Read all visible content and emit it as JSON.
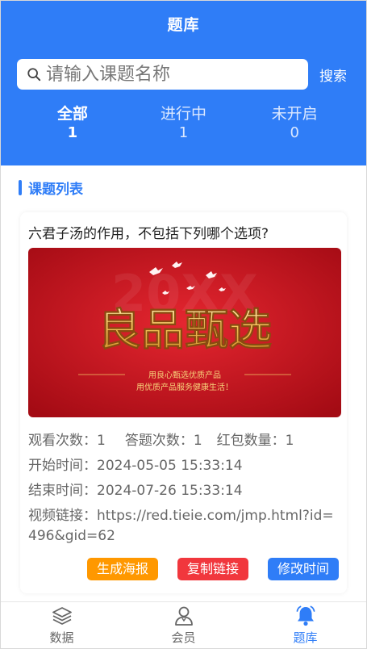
{
  "header": {
    "title": "题库"
  },
  "search": {
    "placeholder": "请输入课题名称",
    "button_label": "搜索"
  },
  "tabs": [
    {
      "label": "全部",
      "count": "1",
      "active": true
    },
    {
      "label": "进行中",
      "count": "1",
      "active": false
    },
    {
      "label": "未开启",
      "count": "0",
      "active": false
    }
  ],
  "section": {
    "title": "课题列表"
  },
  "item": {
    "question": "六君子汤的作用，不包括下列哪个选项?",
    "banner": {
      "title": "良品甄选",
      "watermark": "20XX",
      "line1": "用良心甄选优质产品",
      "line2": "用优质产品服务健康生活！"
    },
    "views_label": "观看次数：",
    "views": "1",
    "answers_label": "答题次数：",
    "answers": "1",
    "redpacket_label": "红包数量：",
    "redpacket": "1",
    "start_label": "开始时间：",
    "start_time": "2024-05-05 15:33:14",
    "end_label": "结束时间：",
    "end_time": "2024-07-26 15:33:14",
    "link_label": "视频链接：",
    "link": "https://red.tieie.com/jmp.html?id=496&gid=62",
    "actions": {
      "poster": "生成海报",
      "copy": "复制链接",
      "edit": "修改时间"
    }
  },
  "nav": [
    {
      "label": "数据",
      "icon": "layers-icon",
      "active": false
    },
    {
      "label": "会员",
      "icon": "user-icon",
      "active": false
    },
    {
      "label": "题库",
      "icon": "bell-icon",
      "active": true
    }
  ],
  "colors": {
    "primary": "#2f7df7",
    "orange": "#ff9800",
    "red": "#f1373d",
    "banner_red": "#c8121e",
    "gold": "#f3c766"
  }
}
